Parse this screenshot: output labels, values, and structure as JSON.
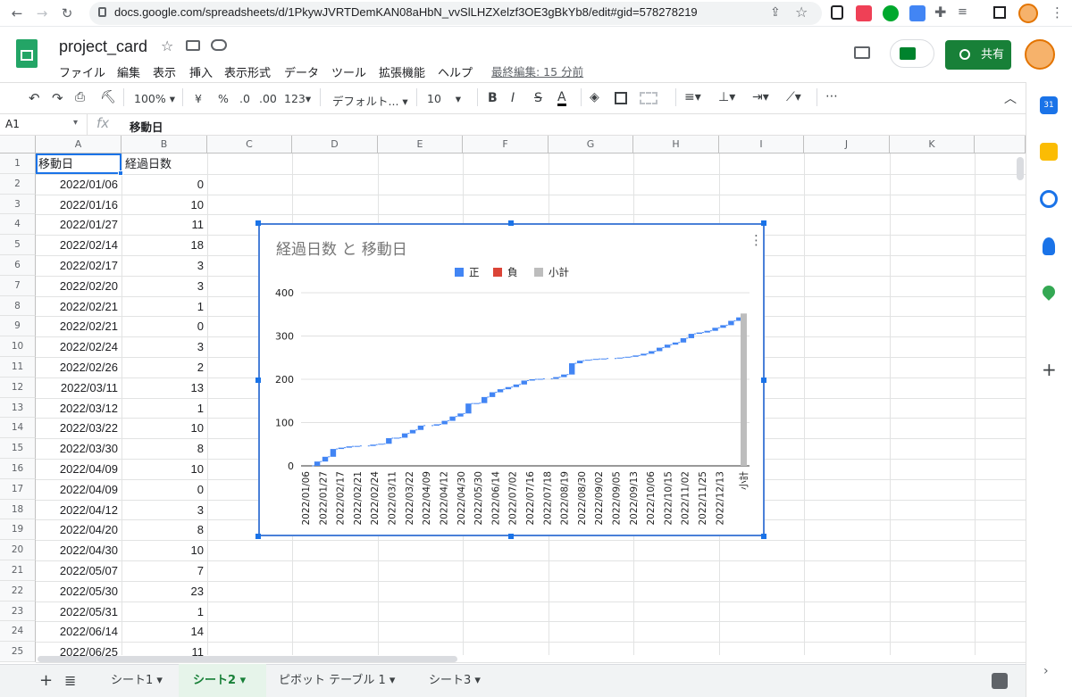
{
  "browser": {
    "url": "docs.google.com/spreadsheets/d/1PkywJVRTDemKAN08aHbN_vvSlLHZXelzf3OE3gBkYb8/edit#gid=578278219"
  },
  "app": {
    "title": "project_card",
    "menu": [
      "ファイル",
      "編集",
      "表示",
      "挿入",
      "表示形式",
      "データ",
      "ツール",
      "拡張機能",
      "ヘルプ"
    ],
    "last_edit": "最終編集: 15 分前",
    "share_label": "共有"
  },
  "toolbar": {
    "zoom": "100%",
    "currency": "¥",
    "percent": "%",
    "dec_decrease": ".0",
    "dec_increase": ".00",
    "number_format": "123",
    "font": "デフォルト...",
    "font_size": "10",
    "bold": "B",
    "italic": "I",
    "strike": "S",
    "text_color": "A"
  },
  "formula_bar": {
    "cell_ref": "A1",
    "fx": "fx",
    "value": "移動日"
  },
  "columns": [
    "A",
    "B",
    "C",
    "D",
    "E",
    "F",
    "G",
    "H",
    "I",
    "J",
    "K"
  ],
  "rows": [
    {
      "n": "1",
      "a": "移動日",
      "b": "経過日数"
    },
    {
      "n": "2",
      "a": "2022/01/06",
      "b": "0"
    },
    {
      "n": "3",
      "a": "2022/01/16",
      "b": "10"
    },
    {
      "n": "4",
      "a": "2022/01/27",
      "b": "11"
    },
    {
      "n": "5",
      "a": "2022/02/14",
      "b": "18"
    },
    {
      "n": "6",
      "a": "2022/02/17",
      "b": "3"
    },
    {
      "n": "7",
      "a": "2022/02/20",
      "b": "3"
    },
    {
      "n": "8",
      "a": "2022/02/21",
      "b": "1"
    },
    {
      "n": "9",
      "a": "2022/02/21",
      "b": "0"
    },
    {
      "n": "10",
      "a": "2022/02/24",
      "b": "3"
    },
    {
      "n": "11",
      "a": "2022/02/26",
      "b": "2"
    },
    {
      "n": "12",
      "a": "2022/03/11",
      "b": "13"
    },
    {
      "n": "13",
      "a": "2022/03/12",
      "b": "1"
    },
    {
      "n": "14",
      "a": "2022/03/22",
      "b": "10"
    },
    {
      "n": "15",
      "a": "2022/03/30",
      "b": "8"
    },
    {
      "n": "16",
      "a": "2022/04/09",
      "b": "10"
    },
    {
      "n": "17",
      "a": "2022/04/09",
      "b": "0"
    },
    {
      "n": "18",
      "a": "2022/04/12",
      "b": "3"
    },
    {
      "n": "19",
      "a": "2022/04/20",
      "b": "8"
    },
    {
      "n": "20",
      "a": "2022/04/30",
      "b": "10"
    },
    {
      "n": "21",
      "a": "2022/05/07",
      "b": "7"
    },
    {
      "n": "22",
      "a": "2022/05/30",
      "b": "23"
    },
    {
      "n": "23",
      "a": "2022/05/31",
      "b": "1"
    },
    {
      "n": "24",
      "a": "2022/06/14",
      "b": "14"
    },
    {
      "n": "25",
      "a": "2022/06/25",
      "b": "11"
    }
  ],
  "tabs": [
    "シート1",
    "シート2",
    "ピボット テーブル 1",
    "シート3"
  ],
  "active_tab": "シート2",
  "chart_data": {
    "type": "waterfall",
    "title": "経過日数 と 移動日",
    "legend": [
      {
        "label": "正",
        "color": "#4285f4"
      },
      {
        "label": "負",
        "color": "#db4437"
      },
      {
        "label": "小計",
        "color": "#bdbdbd"
      }
    ],
    "legend_position": "top",
    "ylim": [
      0,
      400
    ],
    "yticks": [
      "0",
      "100",
      "200",
      "300",
      "400"
    ],
    "xtick_labels": [
      "2022/01/06",
      "2022/01/27",
      "2022/02/17",
      "2022/02/21",
      "2022/02/24",
      "2022/03/11",
      "2022/03/22",
      "2022/04/09",
      "2022/04/12",
      "2022/04/30",
      "2022/05/30",
      "2022/06/14",
      "2022/07/02",
      "2022/07/16",
      "2022/07/18",
      "2022/08/19",
      "2022/08/30",
      "2022/09/02",
      "2022/09/05",
      "2022/09/13",
      "2022/10/06",
      "2022/10/15",
      "2022/11/02",
      "2022/11/25",
      "2022/12/13",
      "小計"
    ],
    "increments": [
      0,
      10,
      11,
      18,
      3,
      3,
      1,
      0,
      3,
      2,
      13,
      1,
      10,
      8,
      10,
      0,
      3,
      8,
      10,
      7,
      23,
      1,
      14,
      11,
      7,
      5,
      6,
      9,
      3,
      1,
      0,
      4,
      6,
      26,
      6,
      2,
      2,
      1,
      0,
      2,
      2,
      3,
      4,
      6,
      8,
      7,
      5,
      10,
      10,
      3,
      4,
      7,
      6,
      10,
      8
    ],
    "subtotal": 352,
    "grid": true
  }
}
